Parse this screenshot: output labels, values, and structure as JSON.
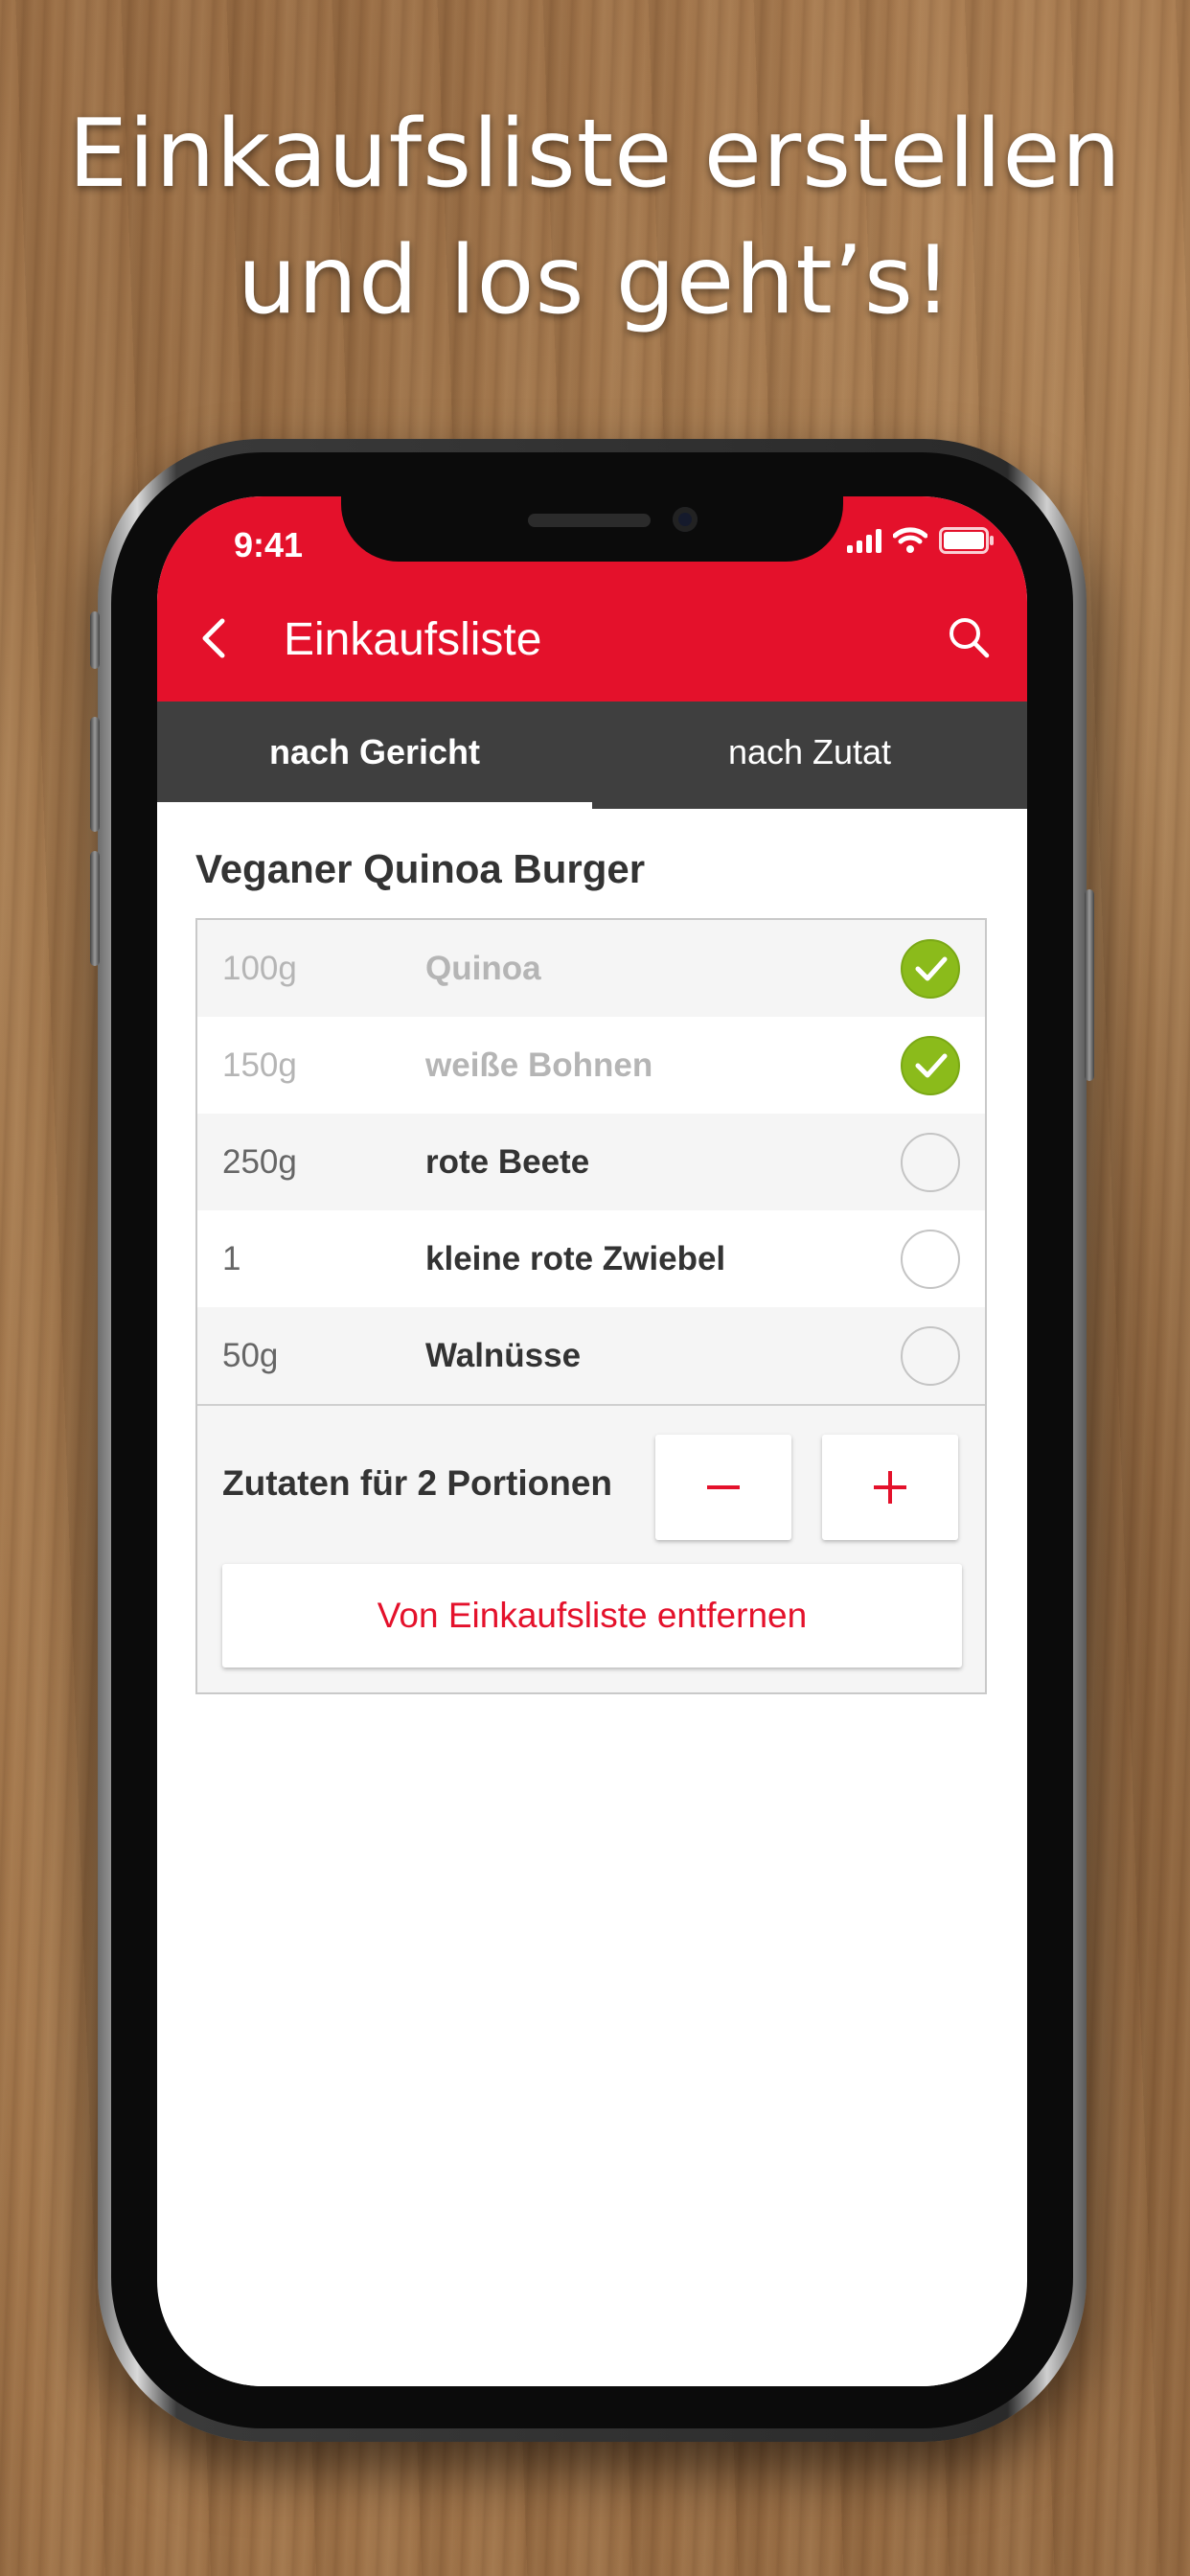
{
  "headline": {
    "line1": "Einkaufsliste erstellen",
    "line2": "und los geht’s!"
  },
  "status_bar": {
    "time": "9:41"
  },
  "app_bar": {
    "title": "Einkaufsliste",
    "back_icon": "chevron-left-icon",
    "search_icon": "search-icon"
  },
  "tabs": [
    {
      "label": "nach Gericht",
      "active": true
    },
    {
      "label": "nach Zutat",
      "active": false
    }
  ],
  "recipe": {
    "title": "Veganer Quinoa Burger",
    "ingredients": [
      {
        "qty": "100g",
        "name": "Quinoa",
        "checked": true
      },
      {
        "qty": "150g",
        "name": "weiße Bohnen",
        "checked": true
      },
      {
        "qty": "250g",
        "name": "rote Beete",
        "checked": false
      },
      {
        "qty": "1",
        "name": "kleine rote Zwiebel",
        "checked": false
      },
      {
        "qty": "50g",
        "name": "Walnüsse",
        "checked": false
      }
    ],
    "portion_label": "Zutaten für 2 Portionen",
    "remove_label": "Von Einkaufsliste entfernen"
  },
  "colors": {
    "accent": "#e4112b",
    "tab_bar": "#3f3f3f",
    "check_green": "#8bbb1b"
  }
}
